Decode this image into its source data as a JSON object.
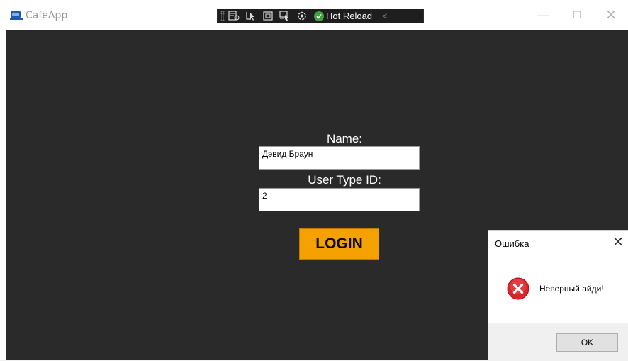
{
  "window": {
    "title": "CafeApp",
    "icon": "coffee-cup-icon"
  },
  "debug_toolbar": {
    "tools": [
      "live-visual-tree-icon",
      "select-element-icon",
      "display-adorners-icon",
      "track-focus-icon",
      "hot-reload-settings-icon"
    ],
    "hot_reload_label": "Hot Reload",
    "collapse_icon": "chevron-left-icon"
  },
  "window_controls": {
    "minimize": "—",
    "maximize": "☐",
    "close": "✕"
  },
  "form": {
    "name_label": "Name:",
    "name_value": "Дэвид Браун",
    "user_type_label": "User Type ID:",
    "user_type_value": "2",
    "login_label": "LOGIN"
  },
  "dialog": {
    "title": "Ошибка",
    "close": "✕",
    "icon": "error-icon",
    "message": "Неверный айди!",
    "ok_label": "OK"
  },
  "colors": {
    "content_bg": "#2a2a2a",
    "login_button": "#f5a100",
    "error_red": "#d9252a",
    "hot_reload_green": "#3fa340"
  }
}
